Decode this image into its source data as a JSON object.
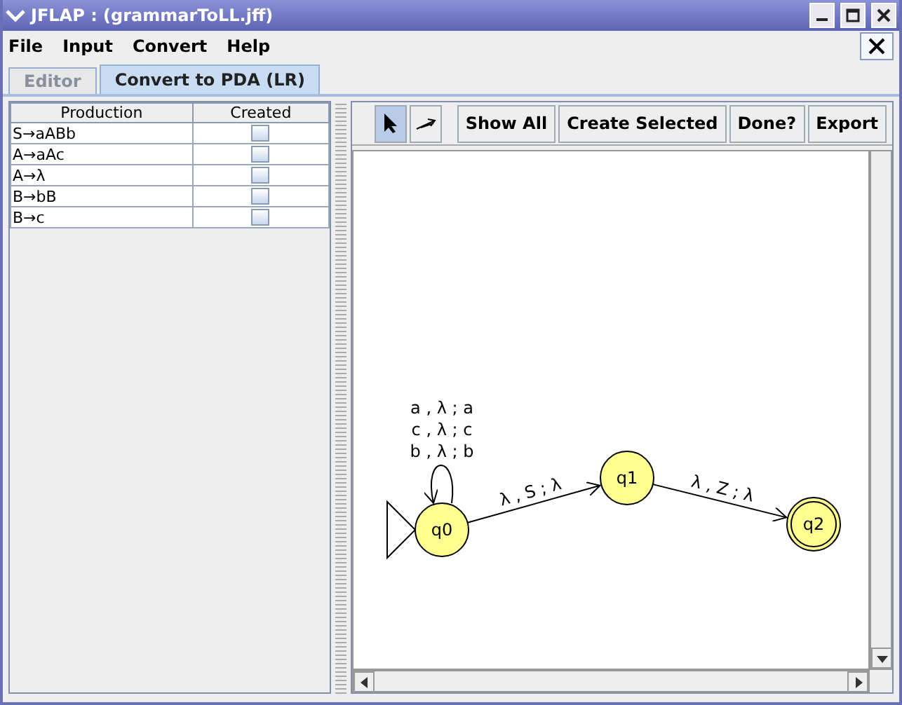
{
  "window": {
    "title": "JFLAP : (grammarToLL.jff)"
  },
  "menu": [
    "File",
    "Input",
    "Convert",
    "Help"
  ],
  "tabs": [
    {
      "label": "Editor",
      "selected": false,
      "disabled": true
    },
    {
      "label": "Convert to PDA (LR)",
      "selected": true,
      "disabled": false
    }
  ],
  "table": {
    "columns": [
      "Production",
      "Created"
    ],
    "rows": [
      {
        "production": "S→aABb",
        "created": false
      },
      {
        "production": "A→aAc",
        "created": false
      },
      {
        "production": "A→λ",
        "created": false
      },
      {
        "production": "B→bB",
        "created": false
      },
      {
        "production": "B→c",
        "created": false
      }
    ]
  },
  "tools": [
    {
      "kind": "select",
      "selected": true
    },
    {
      "kind": "transition",
      "selected": false
    }
  ],
  "buttons": [
    "Show All",
    "Create Selected",
    "Done?",
    "Export"
  ],
  "diagram": {
    "states": [
      {
        "label": "q0",
        "initial": true,
        "final": false
      },
      {
        "label": "q1",
        "initial": false,
        "final": false
      },
      {
        "label": "q2",
        "initial": false,
        "final": true
      }
    ],
    "transitions": [
      {
        "kind": "loop",
        "labels": [
          "a , λ ; a",
          "c , λ ; c",
          "b , λ ; b"
        ]
      },
      {
        "kind": "edge",
        "labels": [
          "λ , S ; λ"
        ]
      },
      {
        "kind": "edge",
        "labels": [
          "λ , Z ; λ"
        ]
      }
    ]
  }
}
